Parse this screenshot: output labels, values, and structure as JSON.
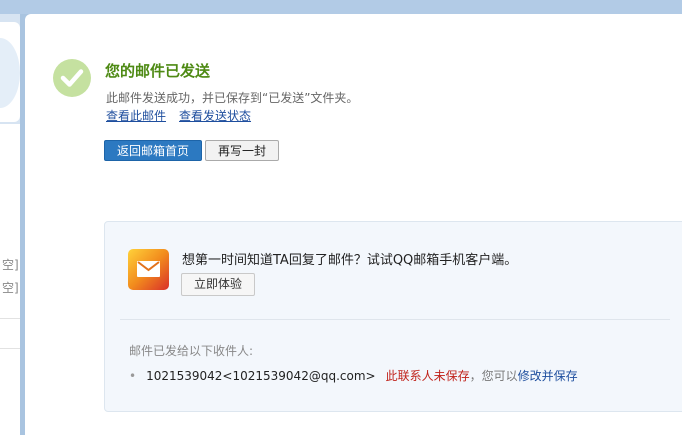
{
  "status": {
    "title": "您的邮件已发送",
    "description": "此邮件发送成功，并已保存到“已发送”文件夹。",
    "links": {
      "view_mail": "查看此邮件",
      "view_status": "查看发送状态"
    }
  },
  "actions": {
    "back_home": "返回邮箱首页",
    "write_another": "再写一封"
  },
  "promo": {
    "text": "想第一时间知道TA回复了邮件？试试QQ邮箱手机客户端。",
    "try_button": "立即体验"
  },
  "recipients": {
    "label": "邮件已发给以下收件人:",
    "items": [
      {
        "address": "1021539042<1021539042@qq.com>",
        "unsaved_note": "此联系人未保存",
        "hint": "，您可以",
        "save_link": "修改并保存"
      }
    ]
  },
  "sidebar": {
    "fragments": [
      "空]",
      "空]"
    ]
  },
  "colors": {
    "success_green": "#4e8a14",
    "primary_button": "#2c79c1",
    "link_blue": "#1e4e9e",
    "warning_red": "#c0221a"
  }
}
